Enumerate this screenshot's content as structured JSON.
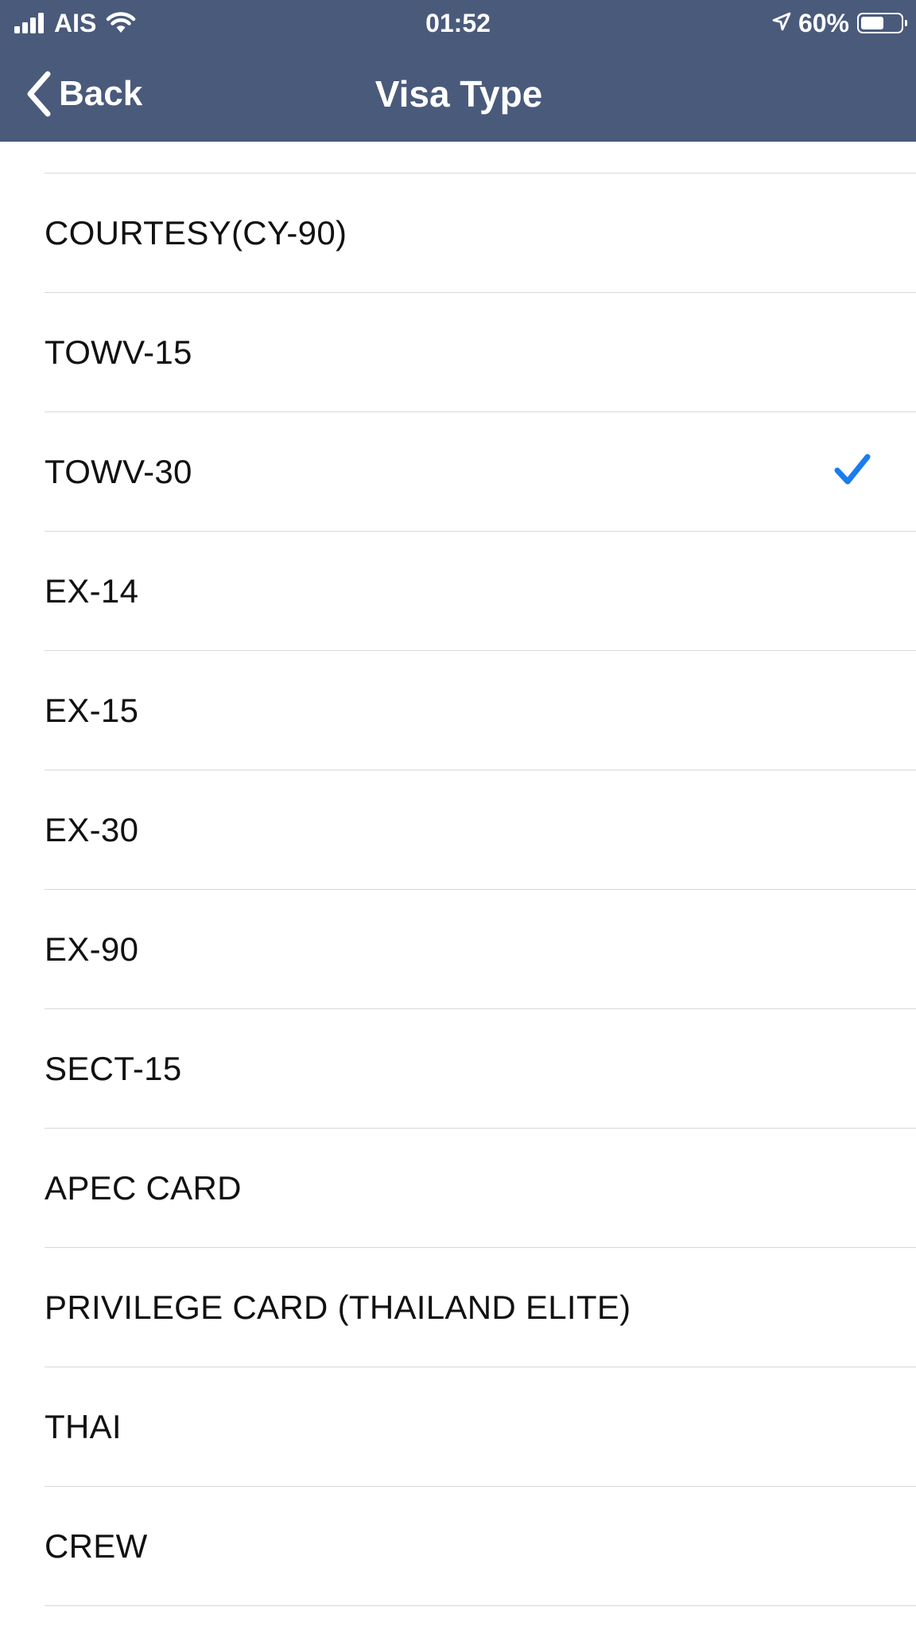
{
  "status_bar": {
    "carrier": "AIS",
    "time": "01:52",
    "battery_percent": "60%",
    "battery_level": 0.6,
    "icons": [
      "signal-icon",
      "wifi-icon",
      "location-arrow-icon",
      "battery-icon"
    ]
  },
  "nav": {
    "back_label": "Back",
    "title": "Visa Type"
  },
  "colors": {
    "header_bg": "#4a5a7b",
    "checkmark": "#1a7cf0",
    "divider": "#d8d8dc"
  },
  "visa_types": [
    {
      "label": "COURTESY(CY-90)",
      "selected": false
    },
    {
      "label": "TOWV-15",
      "selected": false
    },
    {
      "label": "TOWV-30",
      "selected": true
    },
    {
      "label": "EX-14",
      "selected": false
    },
    {
      "label": "EX-15",
      "selected": false
    },
    {
      "label": "EX-30",
      "selected": false
    },
    {
      "label": "EX-90",
      "selected": false
    },
    {
      "label": "SECT-15",
      "selected": false
    },
    {
      "label": "APEC CARD",
      "selected": false
    },
    {
      "label": "PRIVILEGE CARD (THAILAND ELITE)",
      "selected": false
    },
    {
      "label": "THAI",
      "selected": false
    },
    {
      "label": "CREW",
      "selected": false
    }
  ]
}
